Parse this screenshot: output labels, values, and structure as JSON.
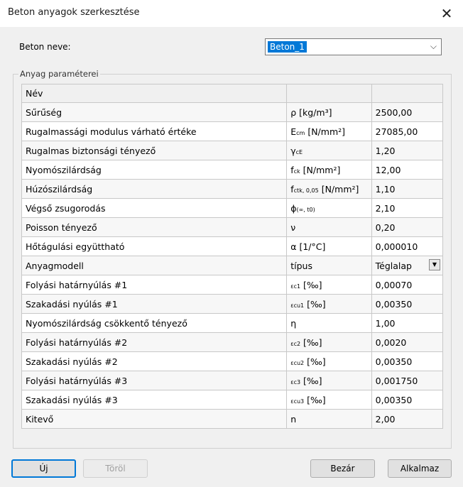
{
  "window": {
    "title": "Beton anyagok szerkesztése",
    "close_glyph": "✕"
  },
  "name_field": {
    "label": "Beton neve:",
    "value": "Beton_1"
  },
  "group": {
    "label": "Anyag paraméterei"
  },
  "table": {
    "header": [
      "Név",
      "",
      ""
    ],
    "rows": [
      {
        "name": "Sűrűség",
        "sym": "ρ [kg/m³]",
        "val": "2500,00"
      },
      {
        "name": "Rugalmassági modulus várható értéke",
        "sym": "E<span class='sub'>cm</span> [N/mm²]",
        "val": "27085,00"
      },
      {
        "name": "Rugalmas biztonsági tényező",
        "sym": "γ<span class='sub'>cE</span>",
        "val": "1,20"
      },
      {
        "name": "Nyomószilárdság",
        "sym": "f<span class='sub'>ck</span> [N/mm²]",
        "val": "12,00"
      },
      {
        "name": "Húzószilárdság",
        "sym": "f<span class='sub'>ctk, 0,05</span> [N/mm²]",
        "val": "1,10"
      },
      {
        "name": "Végső zsugorodás",
        "sym": "ϕ<span class='sub'>(∞, t0)</span>",
        "val": "2,10"
      },
      {
        "name": "Poisson tényező",
        "sym": "ν",
        "val": "0,20"
      },
      {
        "name": "Hőtágulási együttható",
        "sym": "α [1/°C]",
        "val": "0,000010"
      },
      {
        "name": "Anyagmodell",
        "sym": "típus",
        "val": "Téglalap",
        "dropdown": true
      },
      {
        "name": "Folyási határnyúlás #1",
        "sym": "<span class='sub'>εc1</span> [‰]",
        "val": "0,00070"
      },
      {
        "name": "Szakadási nyúlás #1",
        "sym": "<span class='sub'>εcu1</span> [‰]",
        "val": "0,00350"
      },
      {
        "name": "Nyomószilárdság csökkentő tényező",
        "sym": "η",
        "val": "1,00"
      },
      {
        "name": "Folyási határnyúlás #2",
        "sym": "<span class='sub'>εc2</span> [‰]",
        "val": "0,0020"
      },
      {
        "name": "Szakadási nyúlás #2",
        "sym": "<span class='sub'>εcu2</span> [‰]",
        "val": "0,00350"
      },
      {
        "name": "Folyási határnyúlás #3",
        "sym": "<span class='sub'>εc3</span> [‰]",
        "val": "0,001750"
      },
      {
        "name": "Szakadási nyúlás #3",
        "sym": "<span class='sub'>εcu3</span> [‰]",
        "val": "0,00350"
      },
      {
        "name": "Kitevő",
        "sym": "n",
        "val": "2,00"
      }
    ]
  },
  "buttons": {
    "new": "Új",
    "delete": "Töröl",
    "close": "Bezár",
    "apply": "Alkalmaz"
  },
  "icons": {
    "combo_arrow": "chevron-down-icon",
    "dropdown_arrow": "triangle-down-icon"
  }
}
